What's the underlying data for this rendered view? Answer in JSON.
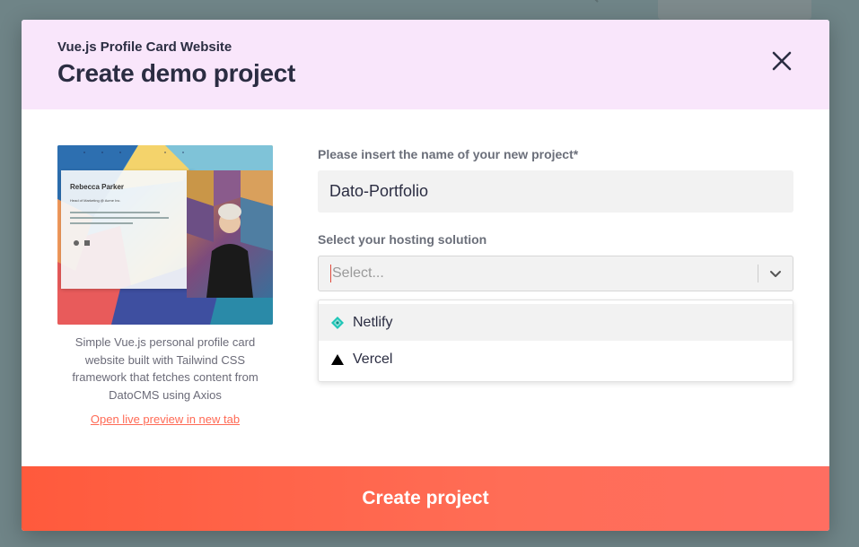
{
  "modal": {
    "subtitle": "Vue.js Profile Card Website",
    "title": "Create demo project"
  },
  "preview": {
    "card_name": "Rebecca Parker",
    "card_role": "Head of Marketing @ Acme Inc.",
    "description": "Simple Vue.js personal profile card website built with Tailwind CSS framework that fetches content from DatoCMS using Axios",
    "link_text": "Open live preview in new tab"
  },
  "form": {
    "name_label": "Please insert the name of your new project*",
    "name_value": "Dato-Portfolio",
    "hosting_label": "Select your hosting solution",
    "hosting_placeholder": "Select...",
    "options": [
      {
        "label": "Netlify",
        "icon": "netlify-icon",
        "color": "#20c6b7"
      },
      {
        "label": "Vercel",
        "icon": "vercel-icon",
        "color": "#000000"
      }
    ]
  },
  "actions": {
    "create_label": "Create project"
  },
  "colors": {
    "accent": "#ff5a3c",
    "header_bg": "#f9e6fb",
    "link": "#ff6a55"
  }
}
